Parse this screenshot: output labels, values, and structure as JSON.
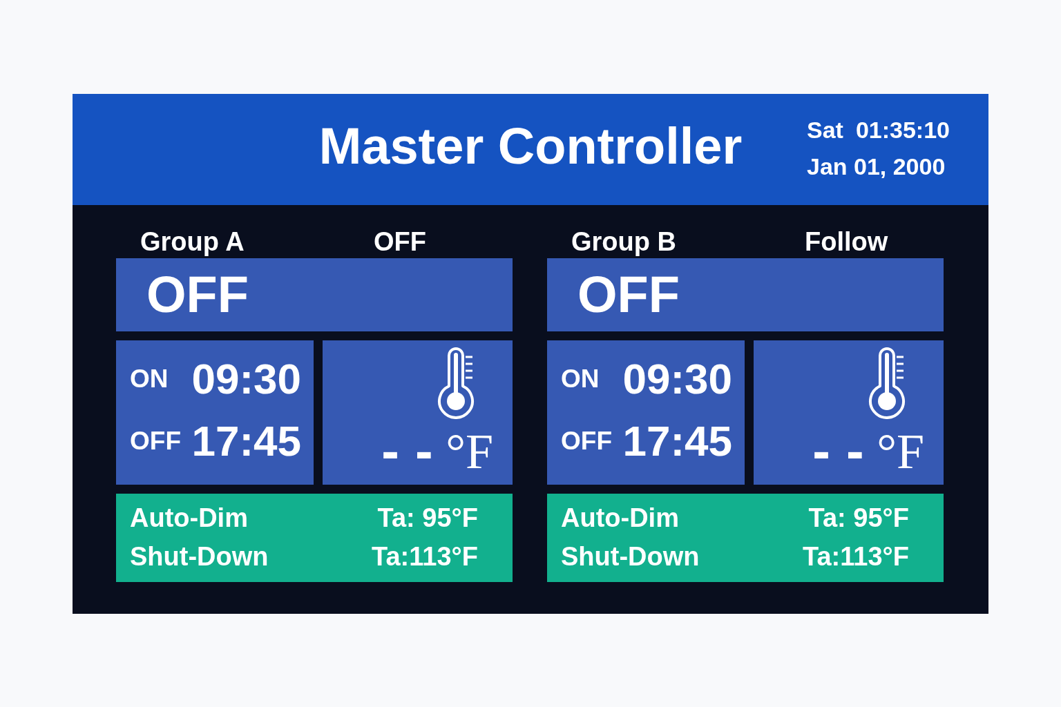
{
  "header": {
    "title": "Master Controller",
    "weekday": "Sat",
    "time": "01:35:10",
    "date": "Jan 01, 2000"
  },
  "groups": [
    {
      "name": "Group A",
      "mode": "OFF",
      "status": "OFF",
      "schedule": [
        {
          "label": "ON",
          "time": "09:30"
        },
        {
          "label": "OFF",
          "time": "17:45"
        }
      ],
      "temperature": {
        "reading": "- -",
        "unit": "°F"
      },
      "thresholds": [
        {
          "label": "Auto-Dim",
          "value": "Ta: 95°F"
        },
        {
          "label": "Shut-Down",
          "value": "Ta:113°F"
        }
      ]
    },
    {
      "name": "Group B",
      "mode": "Follow",
      "status": "OFF",
      "schedule": [
        {
          "label": "ON",
          "time": "09:30"
        },
        {
          "label": "OFF",
          "time": "17:45"
        }
      ],
      "temperature": {
        "reading": "- -",
        "unit": "°F"
      },
      "thresholds": [
        {
          "label": "Auto-Dim",
          "value": "Ta: 95°F"
        },
        {
          "label": "Shut-Down",
          "value": "Ta:113°F"
        }
      ]
    }
  ]
}
